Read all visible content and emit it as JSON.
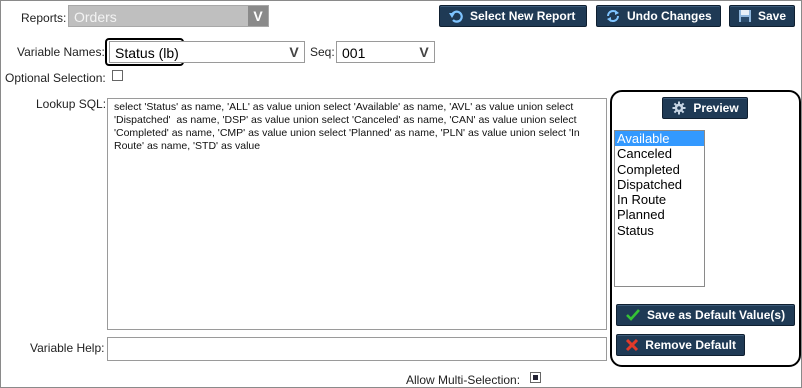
{
  "reports": {
    "label": "Reports:",
    "value": "Orders"
  },
  "toolbar": {
    "select_new_report": "Select New Report",
    "undo_changes": "Undo Changes",
    "save": "Save"
  },
  "variable": {
    "names_label": "Variable Names:",
    "name_value": "Status (lb)",
    "seq_label": "Seq:",
    "seq_value": "001",
    "optional_label": "Optional Selection:",
    "lookup_label": "Lookup SQL:",
    "sql": "select 'Status' as name, 'ALL' as value union select 'Available' as name, 'AVL' as value union select 'Dispatched'  as name, 'DSP' as value union select 'Canceled' as name, 'CAN' as value union select 'Completed' as name, 'CMP' as value union select 'Planned' as name, 'PLN' as value union select 'In Route' as name, 'STD' as value",
    "help_label": "Variable Help:",
    "help_value": "",
    "multi_label": "Allow Multi-Selection:"
  },
  "preview": {
    "button": "Preview",
    "items": [
      "Available",
      "Canceled",
      "Completed",
      "Dispatched",
      "In Route",
      "Planned",
      "Status"
    ],
    "selected_index": 0,
    "save_default": "Save as Default Value(s)",
    "remove_default": "Remove Default"
  },
  "colors": {
    "button_bg": "#1f3a55",
    "selection": "#3399ff"
  }
}
